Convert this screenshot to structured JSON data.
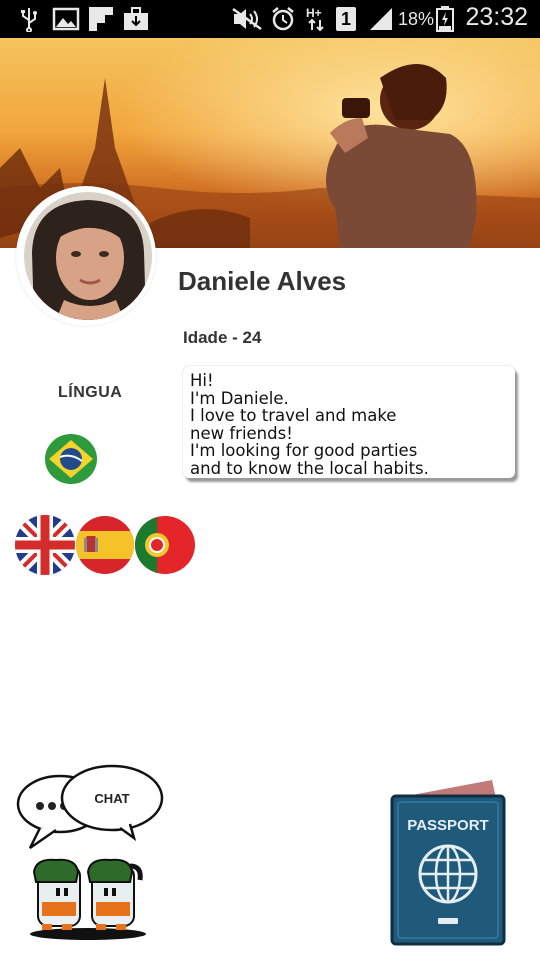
{
  "status_bar": {
    "battery_percent": "18%",
    "time": "23:32",
    "carrier_badge": "1",
    "icons": [
      "usb-icon",
      "image-icon",
      "flipboard-icon",
      "briefcase-icon",
      "mute-icon",
      "alarm-icon",
      "data-arrows-icon",
      "signal-icon",
      "battery-icon"
    ]
  },
  "profile": {
    "name": "Daniele Alves",
    "age_label": "Idade - 24",
    "bio_lines": [
      "Hi!",
      "I'm Daniele.",
      "I love to travel and make",
      "new friends!",
      "I'm looking for good parties",
      "and to know the local habits."
    ]
  },
  "languages": {
    "heading": "LÍNGUA",
    "native": "brazil-flag",
    "spoken": [
      "uk-flag",
      "spain-flag",
      "portugal-flag"
    ]
  },
  "actions": {
    "chat_bubble_text": "CHAT",
    "passport_text": "PASSPORT"
  },
  "colors": {
    "cover_warm": "#f0a03a",
    "passport_blue": "#1f5a7a"
  }
}
